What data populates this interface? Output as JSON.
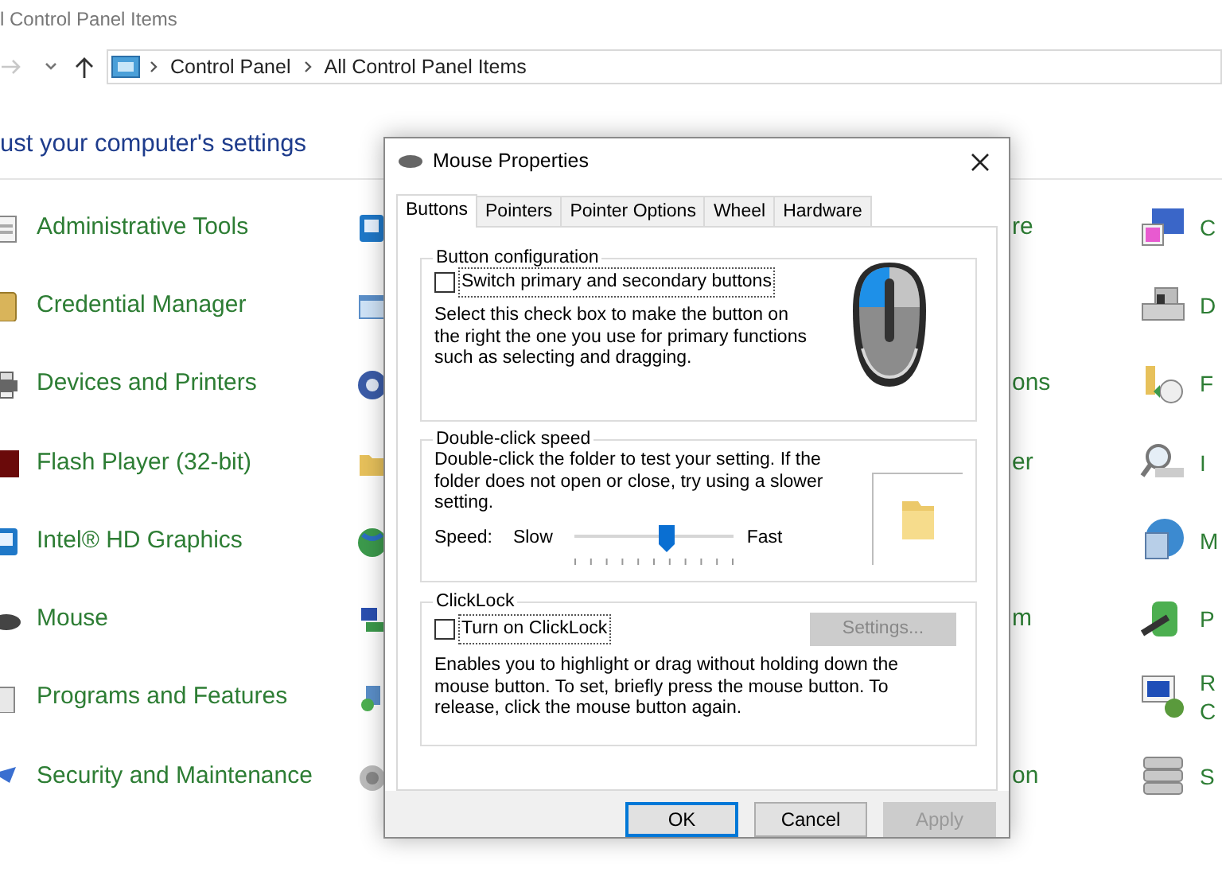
{
  "window": {
    "title": "l Control Panel Items"
  },
  "address": {
    "segments": [
      "Control Panel",
      "All Control Panel Items"
    ]
  },
  "heading": "ust your computer's settings",
  "columns": [
    {
      "items": [
        {
          "label": "Administrative Tools"
        },
        {
          "label": "Credential Manager"
        },
        {
          "label": "Devices and Printers"
        },
        {
          "label": "Flash Player (32-bit)"
        },
        {
          "label": "Intel® HD Graphics"
        },
        {
          "label": "Mouse"
        },
        {
          "label": "Programs and Features"
        },
        {
          "label": "Security and Maintenance"
        }
      ]
    },
    {
      "items": [
        {
          "kind": "labeled",
          "label": "re"
        },
        {
          "kind": "icon"
        },
        {
          "kind": "labeled",
          "label": "ons"
        },
        {
          "kind": "labeled",
          "label": "er"
        },
        {
          "kind": "icon"
        },
        {
          "kind": "labeled",
          "label": "m"
        },
        {
          "kind": "icon"
        },
        {
          "kind": "labeled",
          "label": "on"
        }
      ]
    },
    {
      "items": [
        {
          "label": "C"
        },
        {
          "label": "D"
        },
        {
          "label": "F"
        },
        {
          "label": "I"
        },
        {
          "label": "M"
        },
        {
          "label": "P"
        },
        {
          "label": "R C"
        },
        {
          "label": "S"
        }
      ]
    }
  ],
  "dialog": {
    "title": "Mouse Properties",
    "tabs": [
      {
        "label": "Buttons",
        "selected": true
      },
      {
        "label": "Pointers",
        "selected": false
      },
      {
        "label": "Pointer Options",
        "selected": false
      },
      {
        "label": "Wheel",
        "selected": false
      },
      {
        "label": "Hardware",
        "selected": false
      }
    ],
    "button_configuration": {
      "legend": "Button configuration",
      "checkbox": {
        "label": "Switch primary and secondary buttons",
        "checked": false
      },
      "description": "Select this check box to make the button on the right the one you use for primary functions such as selecting and dragging."
    },
    "double_click_speed": {
      "legend": "Double-click speed",
      "description": "Double-click the folder to test your setting. If the folder does not open or close, try using a slower setting.",
      "slider": {
        "label": "Speed:",
        "min_label": "Slow",
        "max_label": "Fast",
        "level": 0.58
      }
    },
    "clicklock": {
      "legend": "ClickLock",
      "checkbox": {
        "label": "Turn on ClickLock",
        "checked": false
      },
      "settings_button": {
        "label": "Settings...",
        "disabled": true
      },
      "description": "Enables you to highlight or drag without holding down the mouse button. To set, briefly press the mouse button. To release, click the mouse button again."
    },
    "buttons": [
      {
        "label": "OK",
        "default": true,
        "disabled": false
      },
      {
        "label": "Cancel",
        "default": false,
        "disabled": false
      },
      {
        "label": "Apply",
        "default": false,
        "disabled": true
      }
    ]
  }
}
